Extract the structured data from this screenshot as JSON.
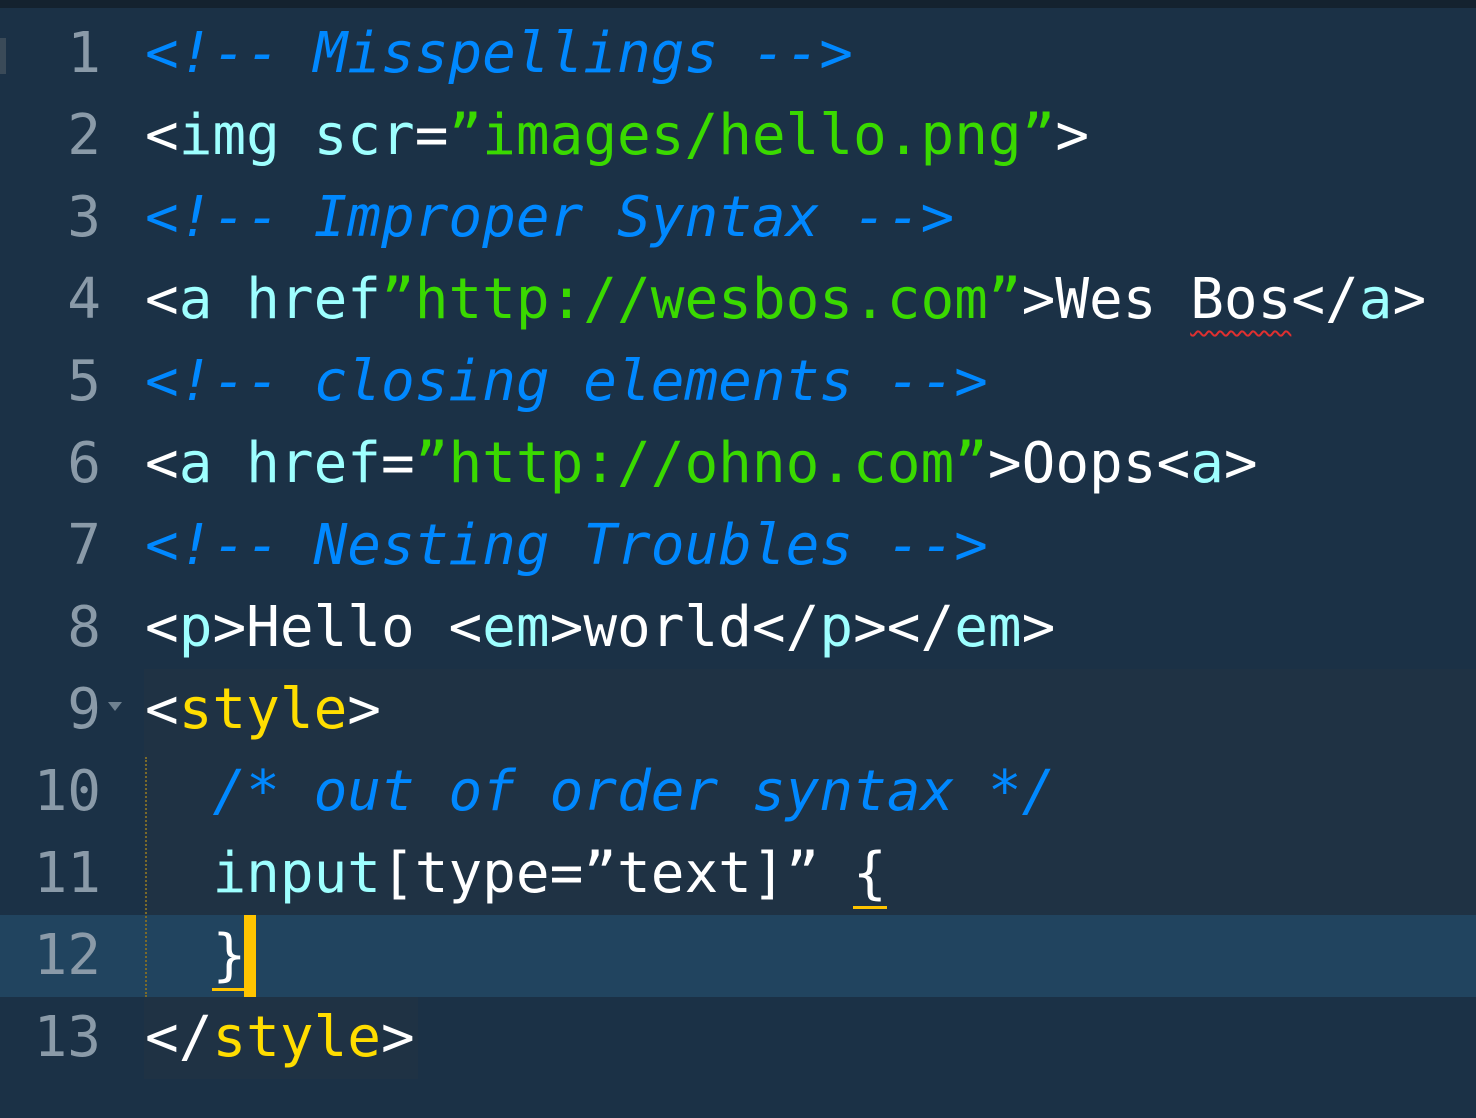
{
  "editor": {
    "theme": {
      "background": "#1b3146",
      "current_line": "#21445f",
      "style_block": "#1f3244",
      "cursor": "#ffc400",
      "comment": "#0088ff",
      "string": "#3ad900",
      "tag": "#9effff",
      "style_tag": "#ffdd00",
      "line_number": "#8a9aa8"
    },
    "line_numbers": [
      "1",
      "2",
      "3",
      "4",
      "5",
      "6",
      "7",
      "8",
      "9",
      "10",
      "11",
      "12",
      "13"
    ],
    "lines": {
      "l1": {
        "comment": "<!-- Misspellings -->"
      },
      "l2": {
        "open": "<",
        "tag": "img",
        "sp": " ",
        "attr": "scr",
        "eq": "=",
        "str": "”images/hello.png”",
        "close": ">"
      },
      "l3": {
        "comment": "<!-- Improper Syntax -->"
      },
      "l4": {
        "open": "<",
        "tag": "a",
        "sp": " ",
        "attr": "href",
        "str": "”http://wesbos.com”",
        "close": ">",
        "text1": "Wes ",
        "text2": "Bos",
        "endopen": "</",
        "endtag": "a",
        "endclose": ">"
      },
      "l5": {
        "comment": "<!-- closing elements -->"
      },
      "l6": {
        "open": "<",
        "tag": "a",
        "sp": " ",
        "attr": "href",
        "eq": "=",
        "str": "”http://ohno.com”",
        "close": ">",
        "text": "Oops",
        "open2": "<",
        "tag2": "a",
        "close2": ">"
      },
      "l7": {
        "comment": "<!-- Nesting Troubles -->"
      },
      "l8": {
        "o1": "<",
        "t1": "p",
        "c1": ">",
        "text1": "Hello ",
        "o2": "<",
        "t2": "em",
        "c2": ">",
        "text2": "world",
        "o3": "</",
        "t3": "p",
        "c3": ">",
        "o4": "</",
        "t4": "em",
        "c4": ">"
      },
      "l9": {
        "open": "<",
        "tag": "style",
        "close": ">"
      },
      "l10": {
        "indent": "  ",
        "comment": "/* out of order syntax */"
      },
      "l11": {
        "indent": "  ",
        "sel": "input",
        "rest": "[type=”text]” ",
        "brace": "{"
      },
      "l12": {
        "indent": "  ",
        "brace": "}"
      },
      "l13": {
        "open": "</",
        "tag": "style",
        "close": ">"
      }
    }
  }
}
